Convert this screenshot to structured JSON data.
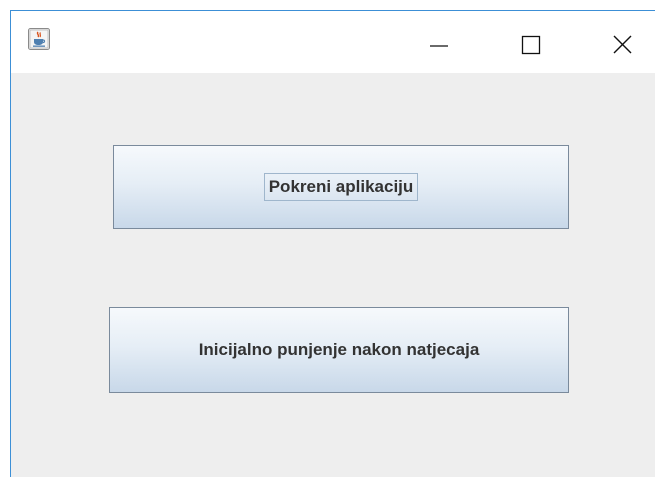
{
  "window": {
    "app_icon": "java-coffee-cup-icon",
    "controls": {
      "minimize": "minimize-icon",
      "maximize": "maximize-icon",
      "close": "close-icon"
    }
  },
  "buttons": {
    "start_app": "Pokreni aplikaciju",
    "initial_fill": "Inicijalno punjenje nakon natjecaja"
  },
  "colors": {
    "window_border": "#3c8fd6",
    "content_bg": "#eeeeee",
    "button_text": "#333333"
  }
}
